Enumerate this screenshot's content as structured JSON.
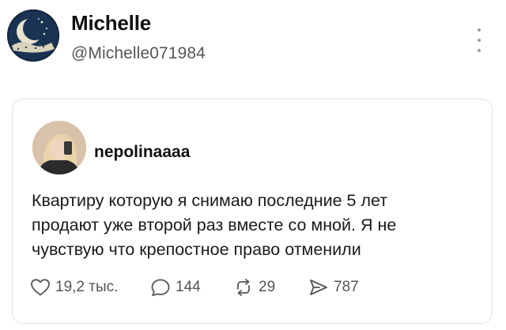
{
  "author": {
    "name": "Michelle",
    "handle": "@Michelle071984"
  },
  "quoted_post": {
    "username": "nepolinaaaa",
    "text_lines": [
      "Квартиру которую я снимаю последние 5 лет",
      "продают уже второй раз вместе со мной. Я не",
      "чувствую что крепостное право отменили"
    ],
    "stats": {
      "likes": "19,2 тыс.",
      "replies": "144",
      "reposts": "29",
      "shares": "787"
    }
  },
  "icons": {
    "more": "more-vertical-icon",
    "like": "heart-icon",
    "reply": "comment-icon",
    "repost": "repost-icon",
    "share": "share-icon"
  },
  "colors": {
    "text": "#111111",
    "muted": "#555555",
    "border": "#e4e4e4"
  }
}
